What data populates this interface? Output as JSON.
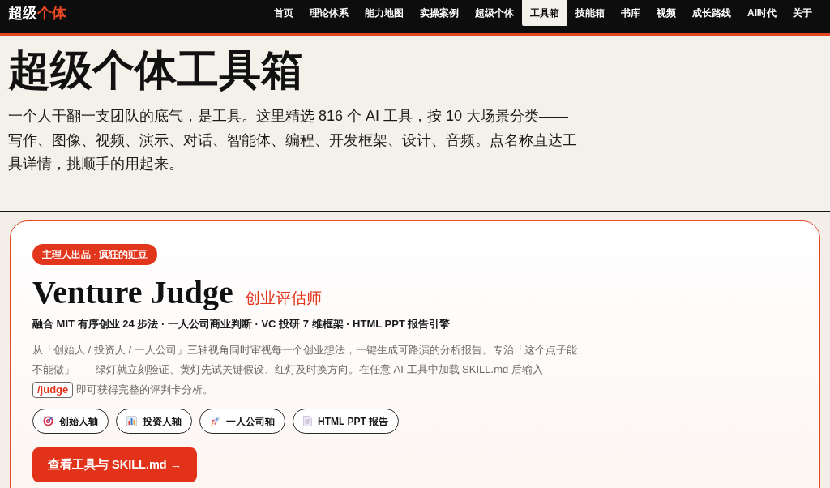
{
  "nav": {
    "logo": {
      "part_1": "超级",
      "part_2": "个体"
    },
    "items": [
      {
        "label": "首页",
        "selected": false
      },
      {
        "label": "理论体系",
        "selected": false
      },
      {
        "label": "能力地图",
        "selected": false
      },
      {
        "label": "实操案例",
        "selected": false
      },
      {
        "label": "超级个体",
        "selected": false
      },
      {
        "label": "工具箱",
        "selected": true
      },
      {
        "label": "技能箱",
        "selected": false
      },
      {
        "label": "书库",
        "selected": false
      },
      {
        "label": "视频",
        "selected": false
      },
      {
        "label": "成长路线",
        "selected": false
      },
      {
        "label": "AI时代",
        "selected": false
      },
      {
        "label": "关于",
        "selected": false
      }
    ]
  },
  "hero": {
    "title": "超级个体工具箱",
    "description": "一个人干翻一支团队的底气，是工具。这里精选 816 个 AI 工具，按 10 大场景分类——写作、图像、视频、演示、对话、智能体、编程、开发框架、设计、音频。点名称直达工具详情，挑顺手的用起来。"
  },
  "featured_card": {
    "badge": "主理人出品 · 疯狂的豇豆",
    "title": "Venture Judge",
    "subtitle": "创业评估师",
    "tagline": "融合 MIT 有序创业 24 步法 · 一人公司商业判断 · VC 投研 7 维框架 · HTML PPT 报告引擎",
    "description": {
      "text_before": "从「创始人 / 投资人 / 一人公司」三轴视角同时审视每一个创业想法，一键生成可路演的分析报告。专治「这个点子能不能做」——绿灯就立刻验证、黄灯先试关键假设、红灯及时换方向。在任意 AI 工具中加载 SKILL.md 后输入",
      "command": "/judge",
      "text_after": "即可获得完整的评判卡分析。"
    },
    "chips": [
      {
        "kind": "target",
        "label": "创始人轴"
      },
      {
        "kind": "chart",
        "label": "投资人轴"
      },
      {
        "kind": "rocket",
        "label": "一人公司轴"
      },
      {
        "kind": "document",
        "label": "HTML PPT 报告"
      }
    ],
    "cta": "查看工具与 SKILL.md →"
  }
}
